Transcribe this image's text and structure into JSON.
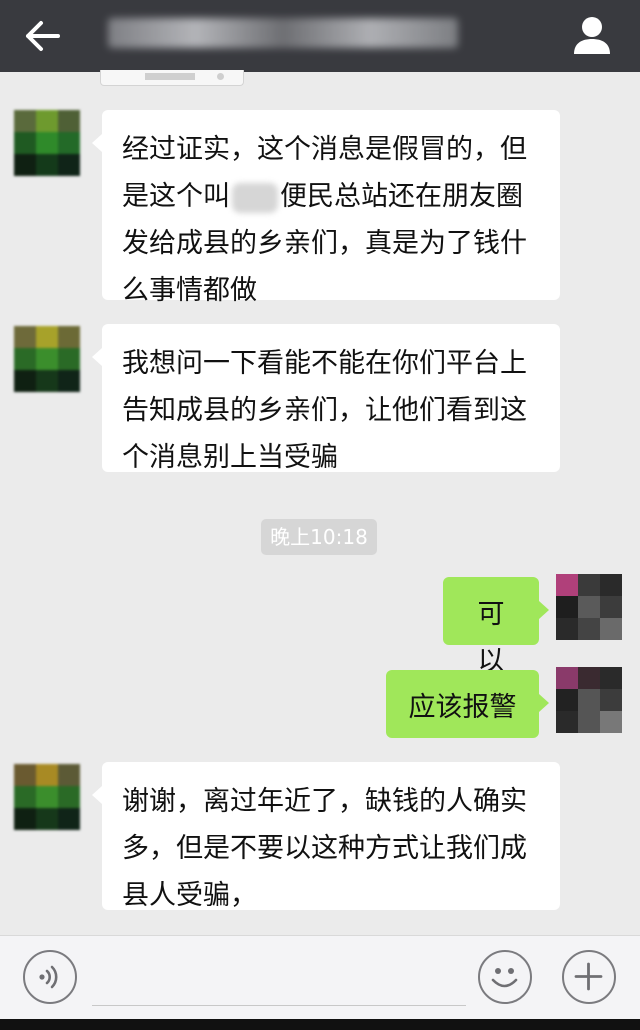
{
  "header": {
    "title": "",
    "back_icon": "arrow-left-icon",
    "profile_icon": "person-icon",
    "bg_color": "#393a3f"
  },
  "messages": [
    {
      "side": "left",
      "line1": "经过证实，这个消息是假冒的，但",
      "line2_pre": "是这个叫",
      "line2_post": "便民总站还在朋友圈",
      "line3": "发给成县的乡亲们，真是为了钱什",
      "line4": "么事情都做"
    },
    {
      "side": "left",
      "line1": "我想问一下看能不能在你们平台上",
      "line2": "告知成县的乡亲们，让他们看到这",
      "line3": "个消息别上当受骗"
    },
    {
      "side": "right",
      "text": "可以"
    },
    {
      "side": "right",
      "text": "应该报警"
    },
    {
      "side": "left",
      "line1": "谢谢，离过年近了，缺钱的人确实",
      "line2": "多，但是不要以这种方式让我们成",
      "line3": "县人受骗，"
    }
  ],
  "timestamp": "晚上10:18",
  "input": {
    "value": "",
    "placeholder": ""
  },
  "icons": {
    "voice": "voice-icon",
    "emoji": "emoji-icon",
    "more": "plus-icon"
  },
  "colors": {
    "background": "#ebebeb",
    "bubble_sent": "#a0e75a",
    "bubble_received": "#ffffff",
    "timestamp_bg": "#d6d6d6"
  }
}
